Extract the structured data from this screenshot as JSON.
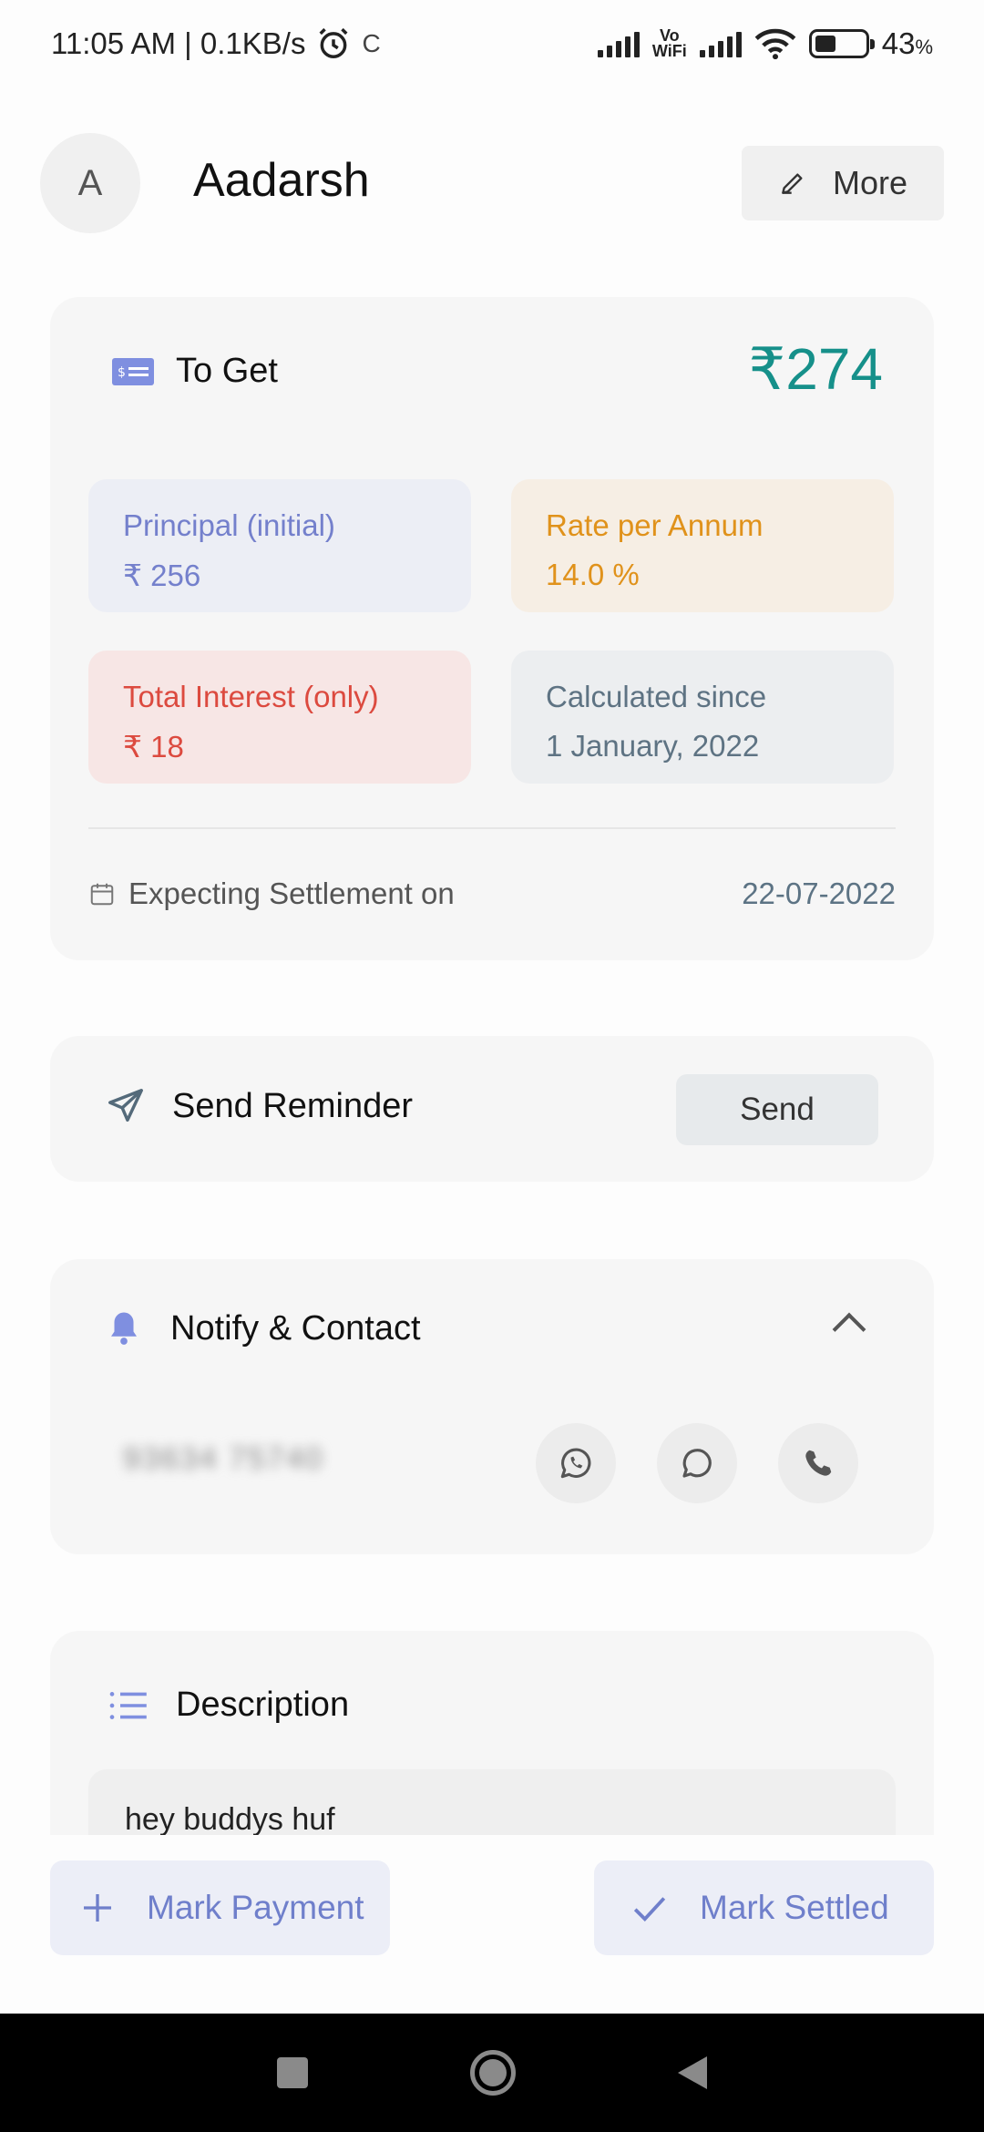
{
  "status_bar": {
    "time_speed": "11:05 AM | 0.1KB/s",
    "extra": "C",
    "vowifi_top": "Vo",
    "vowifi_bottom": "WiFi",
    "battery": "43",
    "battery_unit": "%",
    "battery_level": 0.43
  },
  "header": {
    "avatar_initial": "A",
    "name": "Aadarsh",
    "more_label": "More"
  },
  "summary": {
    "title": "To Get",
    "amount": "₹274",
    "principal_label": "Principal (initial)",
    "principal_value": "₹ 256",
    "rate_label": "Rate per Annum",
    "rate_value": "14.0 %",
    "interest_label": "Total Interest (only)",
    "interest_value": "₹ 18",
    "since_label": "Calculated since",
    "since_value": "1 January, 2022",
    "settlement_label": "Expecting Settlement on",
    "settlement_date": "22-07-2022"
  },
  "reminder": {
    "title": "Send Reminder",
    "send_label": "Send"
  },
  "notify": {
    "title": "Notify & Contact",
    "phone": "93634 75740"
  },
  "description": {
    "title": "Description",
    "text": "hey buddys huf"
  },
  "actions": {
    "mark_payment": "Mark Payment",
    "mark_settled": "Mark Settled"
  },
  "colors": {
    "accent": "#6f7fcb",
    "amount": "#16908a",
    "principal": "#7480cc",
    "rate": "#e0921b",
    "interest": "#dc4a3f",
    "since": "#5e7383"
  }
}
